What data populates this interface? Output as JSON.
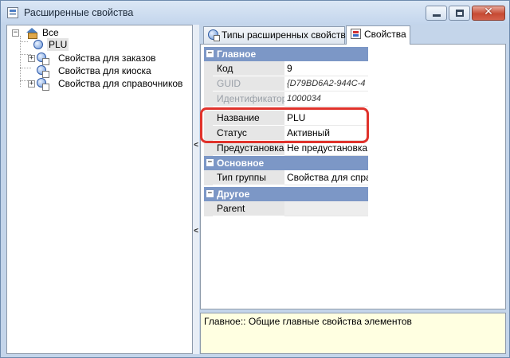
{
  "window": {
    "title": "Расширенные свойства",
    "close_symbol": "✕"
  },
  "tree": {
    "root": {
      "label": "Все",
      "expander": "−"
    },
    "items": [
      {
        "label": "PLU",
        "expander": "",
        "selected": true
      },
      {
        "label": "Свойства для заказов",
        "expander": "+"
      },
      {
        "label": "Свойства для киоска",
        "expander": ""
      },
      {
        "label": "Свойства для справочников",
        "expander": "+"
      }
    ]
  },
  "splitter": {
    "arrow_top": "<",
    "arrow_bottom": "<"
  },
  "tabs": [
    {
      "label": "Типы расширенных свойств",
      "icon": "globe-doc-icon",
      "active": false
    },
    {
      "label": "Свойства",
      "icon": "properties-icon",
      "active": true
    }
  ],
  "property_grid": {
    "collapse_symbol": "−",
    "categories": [
      {
        "title": "Главное",
        "rows": [
          {
            "name": "Код",
            "value": "9",
            "disabled": false
          },
          {
            "name": "GUID",
            "value": "{D79BD6A2-944C-4",
            "disabled": true
          },
          {
            "name": "Идентификатор",
            "value": "1000034",
            "disabled": true
          },
          {
            "name": "Название",
            "value": "PLU",
            "disabled": false
          },
          {
            "name": "Статус",
            "value": "Активный",
            "disabled": false
          },
          {
            "name": "Предустановка",
            "value": "Не предустановка",
            "disabled": false
          }
        ]
      },
      {
        "title": "Основное",
        "rows": [
          {
            "name": "Тип группы",
            "value": "Свойства для спра",
            "disabled": false
          }
        ]
      },
      {
        "title": "Другое",
        "rows": [
          {
            "name": "Parent",
            "value": "",
            "disabled": false
          }
        ]
      }
    ]
  },
  "description": "Главное:: Общие главные свойства элементов",
  "colors": {
    "category_header": "#7c97c6",
    "highlight_border": "#e0322b",
    "description_bg": "#ffffe1"
  }
}
